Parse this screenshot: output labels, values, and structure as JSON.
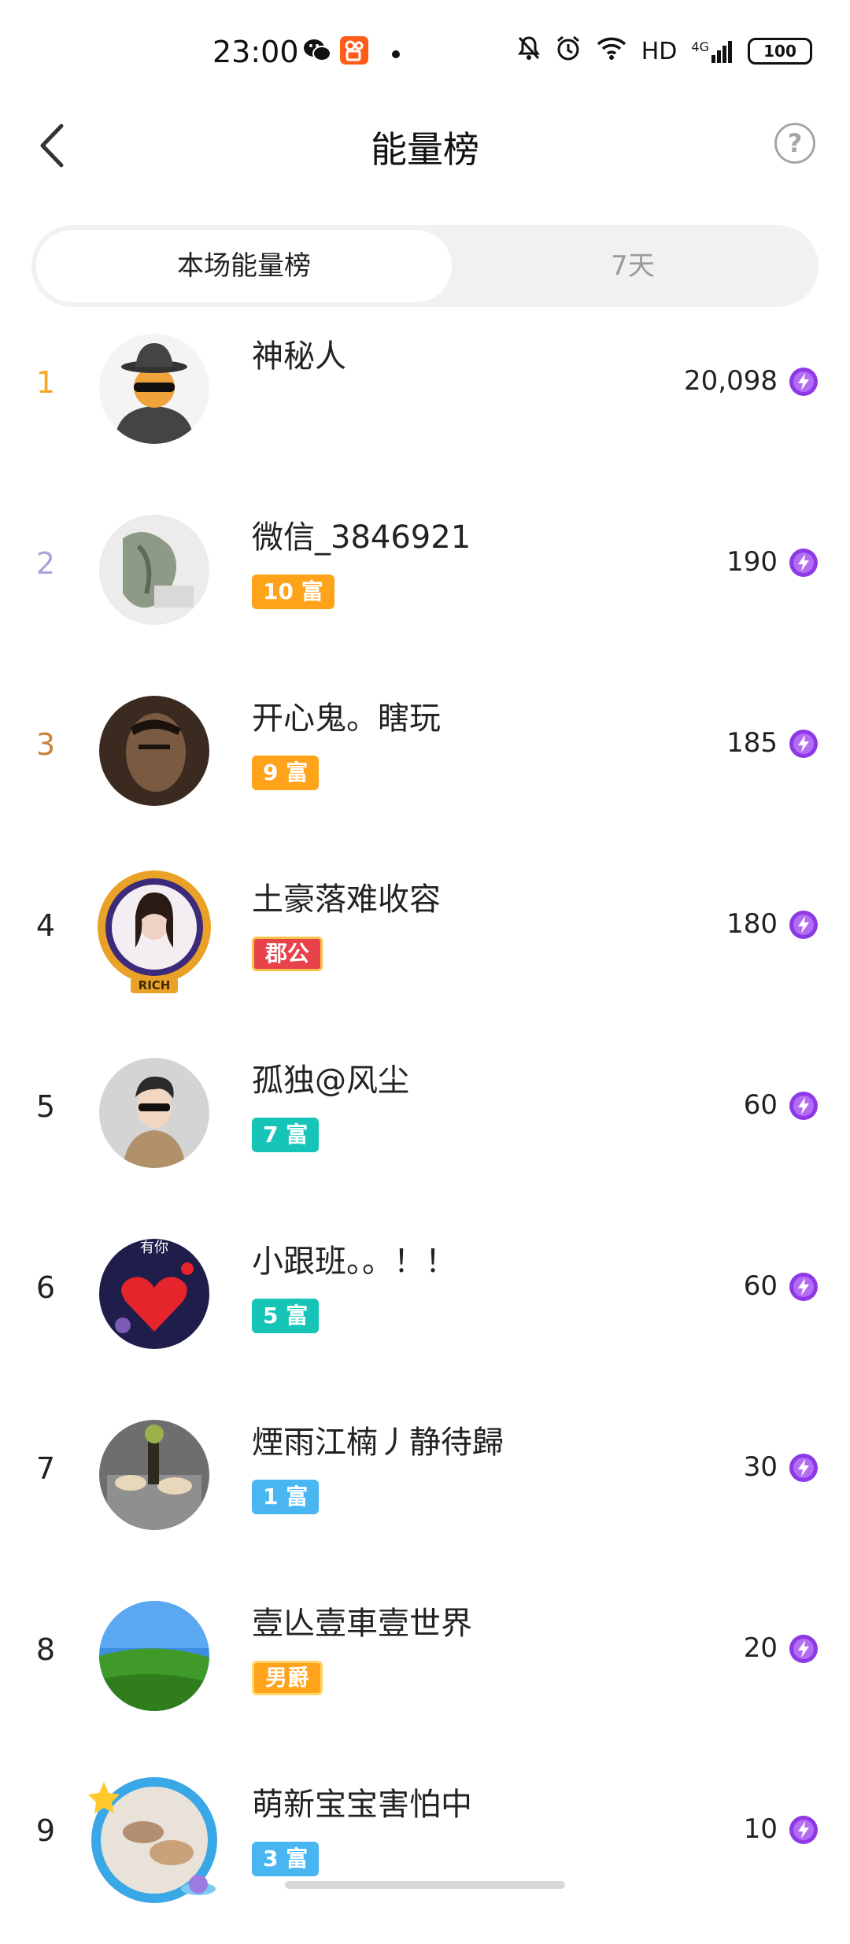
{
  "status_bar": {
    "time": "23:00",
    "network": "HD",
    "signal": "4G",
    "battery": "100",
    "icons": [
      "wechat-icon",
      "kuaishou-icon",
      "dot-icon",
      "mute-bell-icon",
      "alarm-icon",
      "wifi-icon"
    ]
  },
  "header": {
    "title": "能量榜",
    "back_icon": "chevron-left-icon",
    "help_icon": "help-circle-icon",
    "help_label": "?"
  },
  "tabs": [
    {
      "label": "本场能量榜",
      "active": true
    },
    {
      "label": "7天",
      "active": false
    }
  ],
  "colors": {
    "rank_gold": "#F5A623",
    "rank_silver": "#A9A7D6",
    "rank_bronze": "#C8823A",
    "energy_purple": "#8E39E6",
    "badge_orange": "#FFA31A",
    "badge_teal": "#16C5B7",
    "badge_blue": "#49B6F2",
    "badge_red": "#E8424A"
  },
  "rankings": [
    {
      "rank": "1",
      "name": "神秘人",
      "score": "20,098",
      "badge": ""
    },
    {
      "rank": "2",
      "name": "微信_3846921",
      "score": "190",
      "badge": "10 富"
    },
    {
      "rank": "3",
      "name": "开心鬼。瞎玩",
      "score": "185",
      "badge": "9 富"
    },
    {
      "rank": "4",
      "name": "土豪落难收容",
      "score": "180",
      "badge": "郡公",
      "avatar_frame_text": "RICH"
    },
    {
      "rank": "5",
      "name": "孤独@风尘",
      "score": "60",
      "badge": "7 富"
    },
    {
      "rank": "6",
      "name": "小跟班。。！！",
      "score": "60",
      "badge": "5 富",
      "avatar_text": "有你"
    },
    {
      "rank": "7",
      "name": "煙雨江楠丿静待歸",
      "score": "30",
      "badge": "1 富"
    },
    {
      "rank": "8",
      "name": "壹亾壹車壹世界",
      "score": "20",
      "badge": "男爵"
    },
    {
      "rank": "9",
      "name": "萌新宝宝害怕中",
      "score": "10",
      "badge": "3 富"
    }
  ]
}
